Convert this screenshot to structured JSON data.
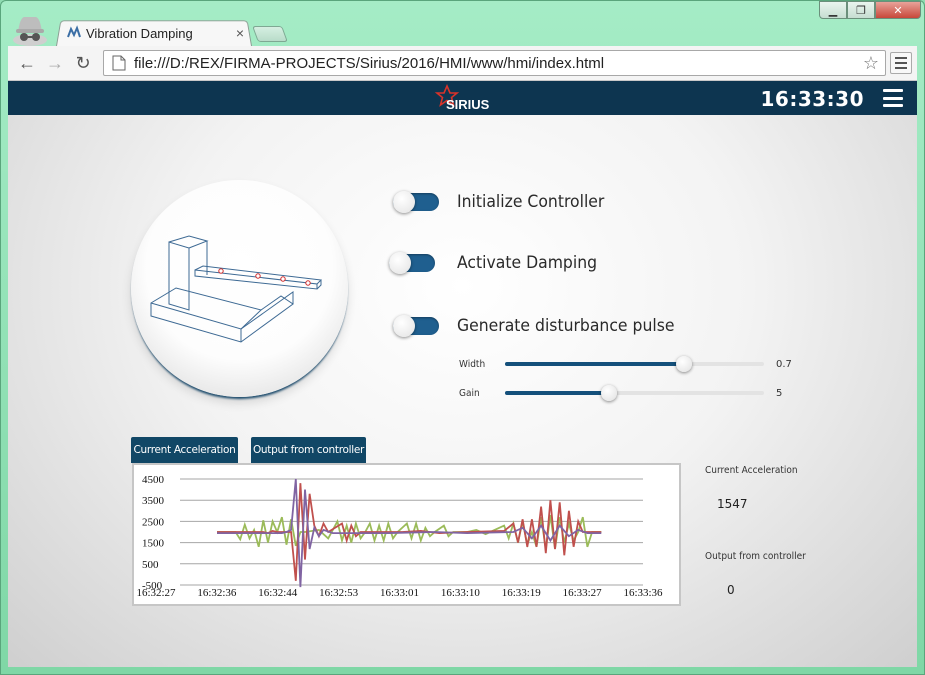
{
  "browser": {
    "tab_title": "Vibration Damping",
    "tab_close": "×",
    "address": "file:///D:/REX/FIRMA-PROJECTS/Sirius/2016/HMI/www/hmi/index.html",
    "window_controls": {
      "minimize": "▁",
      "maximize": "❐",
      "close": "✕"
    },
    "nav": {
      "back": "←",
      "forward": "→",
      "reload": "↻"
    },
    "bookmark_star": "☆"
  },
  "header": {
    "logo_text": "SIRIUS",
    "clock": "16:33:30",
    "colors": {
      "bar": "#0d3550",
      "logo_star": "#d8332a"
    }
  },
  "controls": {
    "toggles": [
      {
        "label": "Initialize Controller",
        "state": "on"
      },
      {
        "label": "Activate Damping",
        "state": "off"
      },
      {
        "label": "Generate disturbance pulse",
        "state": "on"
      }
    ],
    "sliders": [
      {
        "label": "Width",
        "value": 0.7,
        "display": "0.7",
        "fraction": 0.69
      },
      {
        "label": "Gain",
        "value": 5,
        "display": "5",
        "fraction": 0.4
      }
    ]
  },
  "chart_tabs": [
    "Current Acceleration",
    "Output from controller"
  ],
  "readouts": [
    {
      "label": "Current Acceleration",
      "value": "1547"
    },
    {
      "label": "Output from controller",
      "value": "0"
    }
  ],
  "chart_data": {
    "type": "line",
    "y_ticks": [
      "4500",
      "3500",
      "2500",
      "1500",
      "500",
      "-500"
    ],
    "x_ticks": [
      "16:32:27",
      "16:32:36",
      "16:32:44",
      "16:32:53",
      "16:33:01",
      "16:33:10",
      "16:33:19",
      "16:33:27",
      "16:33:36"
    ],
    "ylim": [
      -500,
      4500
    ],
    "grid": true,
    "series": [
      {
        "color": "#9bbb59",
        "values": [
          [
            8,
            2000
          ],
          [
            12,
            2000
          ],
          [
            13,
            1650
          ],
          [
            14,
            2350
          ],
          [
            15,
            1700
          ],
          [
            16,
            2100
          ],
          [
            17,
            1300
          ],
          [
            18,
            2550
          ],
          [
            19,
            1500
          ],
          [
            20,
            2500
          ],
          [
            21,
            2000
          ],
          [
            22,
            2700
          ],
          [
            23,
            1400
          ],
          [
            24,
            2600
          ],
          [
            25,
            1350
          ],
          [
            26,
            2000
          ],
          [
            27,
            2000
          ],
          [
            30,
            2100
          ],
          [
            32,
            1700
          ],
          [
            34,
            2500
          ],
          [
            35,
            1600
          ],
          [
            36,
            2300
          ],
          [
            37,
            1500
          ],
          [
            38,
            2400
          ],
          [
            39,
            1700
          ],
          [
            40,
            2000
          ],
          [
            41,
            2400
          ],
          [
            42,
            1600
          ],
          [
            43,
            2300
          ],
          [
            44,
            1600
          ],
          [
            45,
            2400
          ],
          [
            46,
            1700
          ],
          [
            47,
            2000
          ],
          [
            49,
            2400
          ],
          [
            50,
            1700
          ],
          [
            51,
            2400
          ],
          [
            52,
            1600
          ],
          [
            53,
            2200
          ],
          [
            54,
            1800
          ],
          [
            55,
            2000
          ],
          [
            57,
            2300
          ],
          [
            58,
            1800
          ],
          [
            59,
            2000
          ],
          [
            62,
            2000
          ],
          [
            64,
            2100
          ],
          [
            66,
            1900
          ],
          [
            67,
            2000
          ],
          [
            70,
            2300
          ],
          [
            71,
            1700
          ],
          [
            72,
            2400
          ],
          [
            73,
            1500
          ],
          [
            74,
            2500
          ],
          [
            75,
            1400
          ],
          [
            76,
            2000
          ],
          [
            77,
            1300
          ],
          [
            78,
            2700
          ],
          [
            79,
            1200
          ],
          [
            80,
            2800
          ],
          [
            81,
            1200
          ],
          [
            82,
            2700
          ],
          [
            83,
            1500
          ],
          [
            84,
            2400
          ],
          [
            85,
            1600
          ],
          [
            86,
            2000
          ],
          [
            87,
            2700
          ],
          [
            88,
            1300
          ],
          [
            89,
            2000
          ],
          [
            91,
            2000
          ]
        ]
      },
      {
        "color": "#c0504d",
        "values": [
          [
            8,
            2000
          ],
          [
            16,
            2000
          ],
          [
            18,
            2000
          ],
          [
            19,
            1950
          ],
          [
            20,
            2050
          ],
          [
            21,
            2000
          ],
          [
            24,
            2000
          ],
          [
            25,
            -300
          ],
          [
            26,
            4300
          ],
          [
            27,
            700
          ],
          [
            28,
            3800
          ],
          [
            29,
            2300
          ],
          [
            30,
            1800
          ],
          [
            31,
            2400
          ],
          [
            32,
            2000
          ],
          [
            35,
            2400
          ],
          [
            36,
            1600
          ],
          [
            37,
            2300
          ],
          [
            38,
            1800
          ],
          [
            39,
            2000
          ],
          [
            48,
            2000
          ],
          [
            52,
            2050
          ],
          [
            56,
            1950
          ],
          [
            62,
            2000
          ],
          [
            70,
            2050
          ],
          [
            72,
            2400
          ],
          [
            73,
            1500
          ],
          [
            74,
            2600
          ],
          [
            75,
            1300
          ],
          [
            76,
            2600
          ],
          [
            77,
            1300
          ],
          [
            78,
            3200
          ],
          [
            79,
            1000
          ],
          [
            80,
            3500
          ],
          [
            81,
            1200
          ],
          [
            82,
            3400
          ],
          [
            83,
            900
          ],
          [
            84,
            3000
          ],
          [
            85,
            1300
          ],
          [
            86,
            2500
          ],
          [
            87,
            2000
          ],
          [
            91,
            2000
          ]
        ]
      },
      {
        "color": "#8064a2",
        "values": [
          [
            8,
            1950
          ],
          [
            22,
            1950
          ],
          [
            23,
            2000
          ],
          [
            24,
            2100
          ],
          [
            25,
            4500
          ],
          [
            26,
            -600
          ],
          [
            27,
            4000
          ],
          [
            28,
            1200
          ],
          [
            29,
            2200
          ],
          [
            30,
            1800
          ],
          [
            31,
            2100
          ],
          [
            33,
            1950
          ],
          [
            45,
            1950
          ],
          [
            55,
            2000
          ],
          [
            62,
            1950
          ],
          [
            72,
            2000
          ],
          [
            74,
            2200
          ],
          [
            76,
            1700
          ],
          [
            78,
            2300
          ],
          [
            80,
            1600
          ],
          [
            82,
            2300
          ],
          [
            84,
            1800
          ],
          [
            86,
            2100
          ],
          [
            88,
            1950
          ],
          [
            91,
            1950
          ]
        ]
      }
    ]
  }
}
